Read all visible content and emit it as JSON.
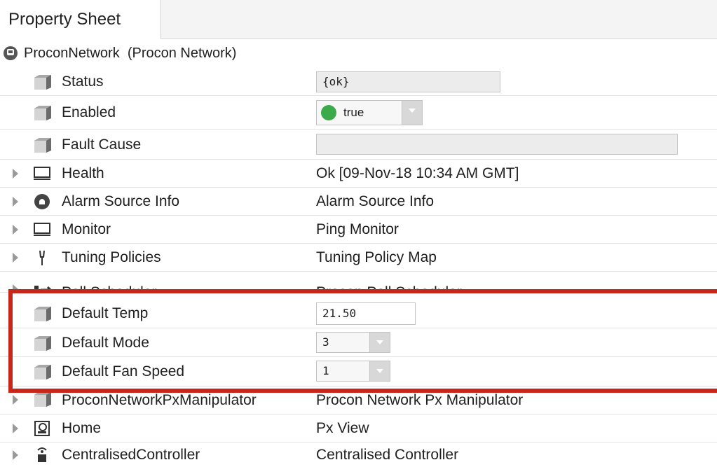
{
  "tab": {
    "label": "Property Sheet"
  },
  "root": {
    "name": "ProconNetwork",
    "type": "(Procon Network)"
  },
  "rows": [
    {
      "label": "Status",
      "value": "{ok}"
    },
    {
      "label": "Enabled",
      "value": "true"
    },
    {
      "label": "Fault Cause",
      "value": ""
    },
    {
      "label": "Health",
      "value": "Ok [09-Nov-18 10:34 AM GMT]"
    },
    {
      "label": "Alarm Source Info",
      "value": "Alarm Source Info"
    },
    {
      "label": "Monitor",
      "value": "Ping Monitor"
    },
    {
      "label": "Tuning Policies",
      "value": "Tuning Policy Map"
    },
    {
      "label": "Poll Scheduler",
      "value": "Procon Poll Scheduler"
    },
    {
      "label": "Default Temp",
      "value": "21.50"
    },
    {
      "label": "Default Mode",
      "value": "3"
    },
    {
      "label": "Default Fan Speed",
      "value": "1"
    },
    {
      "label": "ProconNetworkPxManipulator",
      "value": "Procon Network Px Manipulator"
    },
    {
      "label": "Home",
      "value": "Px View"
    },
    {
      "label": "CentralisedController",
      "value": "Centralised Controller"
    }
  ],
  "colors": {
    "highlight": "#c8261a",
    "enabled_dot": "#3aaa4a"
  }
}
